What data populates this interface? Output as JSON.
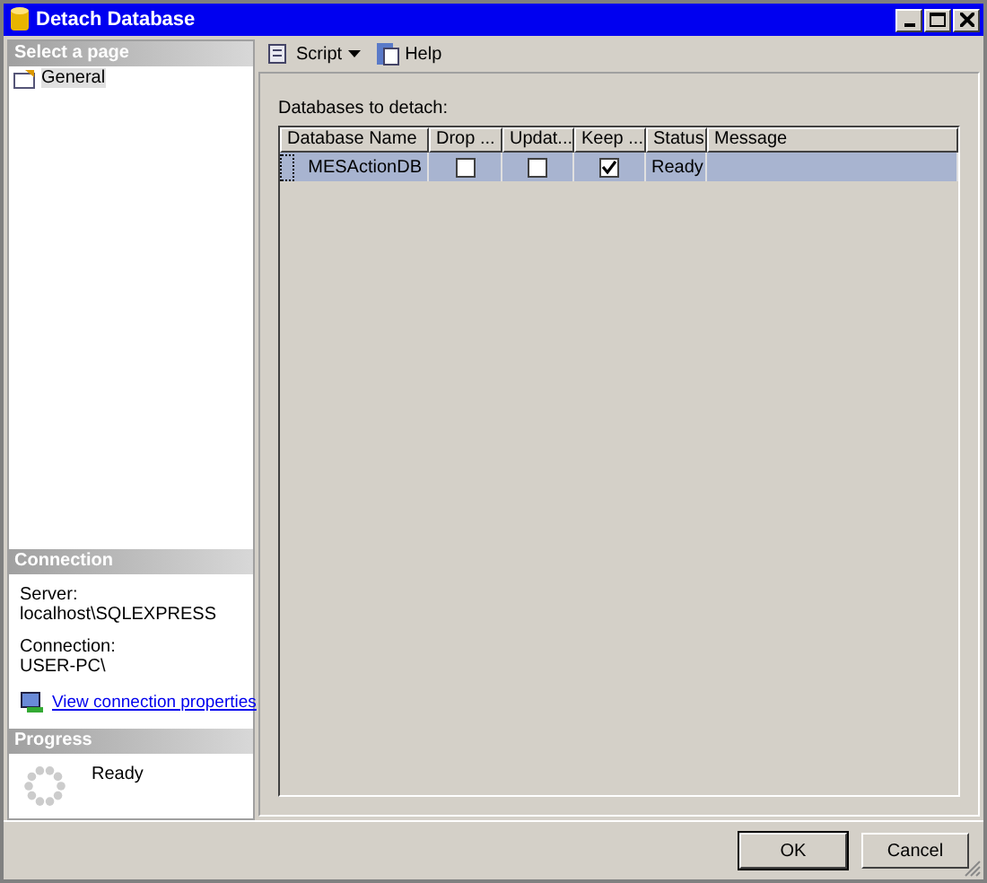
{
  "window": {
    "title": "Detach Database"
  },
  "sidebar": {
    "header": "Select a page",
    "items": [
      {
        "label": "General",
        "selected": true
      }
    ]
  },
  "connection": {
    "header": "Connection",
    "server_label": "Server:",
    "server": "localhost\\SQLEXPRESS",
    "connection_label": "Connection:",
    "connection": "USER-PC\\",
    "link": "View connection properties"
  },
  "progress": {
    "header": "Progress",
    "status": "Ready"
  },
  "toolbar": {
    "script": "Script",
    "help": "Help"
  },
  "table": {
    "caption": "Databases to detach:",
    "columns": [
      "Database Name",
      "Drop ...",
      "Updat...",
      "Keep ...",
      "Status",
      "Message"
    ],
    "rows": [
      {
        "name": "MESActionDB",
        "drop": false,
        "update": false,
        "keep": true,
        "status": "Ready",
        "selected": true
      }
    ]
  },
  "buttons": [
    {
      "label": "OK",
      "kind": "default"
    },
    {
      "label": "Cancel",
      "kind": "normal"
    }
  ]
}
